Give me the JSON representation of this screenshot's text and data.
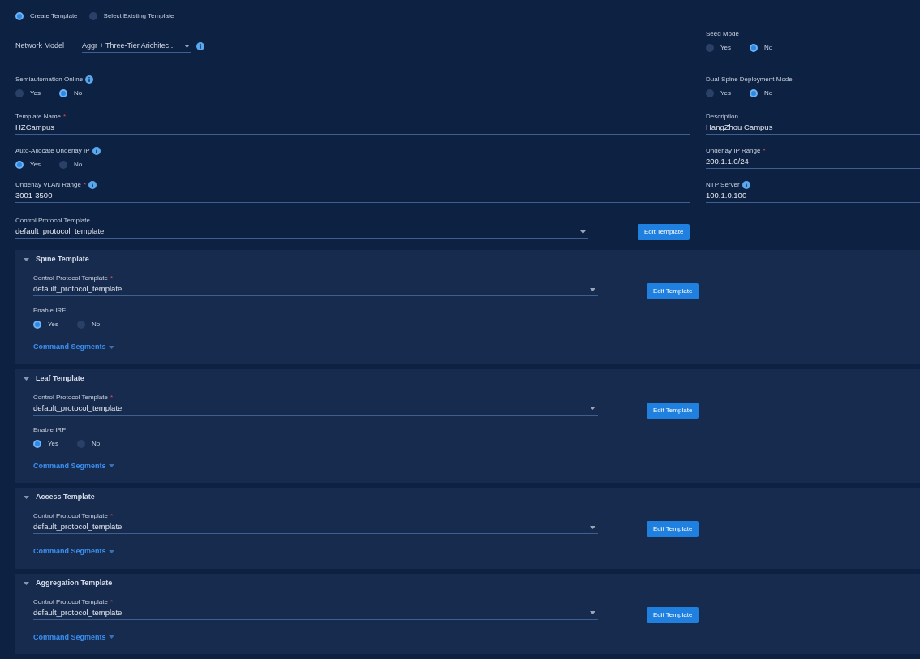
{
  "template_mode": [
    {
      "label": "Create Template",
      "selected": true
    },
    {
      "label": "Select Existing Template",
      "selected": false
    }
  ],
  "rows": [
    {
      "left": {
        "kind": "inline_select",
        "label": "Network Model",
        "value": "Aggr + Three-Tier Arichitec...",
        "info": true
      },
      "right": {
        "kind": "radio",
        "label": "Seed Mode",
        "options": [
          {
            "label": "Yes",
            "selected": false
          },
          {
            "label": "No",
            "selected": true
          }
        ]
      }
    },
    {
      "left": {
        "kind": "radio",
        "label": "Semiautomation Online",
        "info": true,
        "options": [
          {
            "label": "Yes",
            "selected": false
          },
          {
            "label": "No",
            "selected": true
          }
        ]
      },
      "right": {
        "kind": "radio",
        "label": "Dual-Spine Deployment Model",
        "options": [
          {
            "label": "Yes",
            "selected": false
          },
          {
            "label": "No",
            "selected": true
          }
        ]
      }
    },
    {
      "left": {
        "kind": "text",
        "label": "Template Name",
        "required_mark": "*",
        "value": "HZCampus"
      },
      "right": {
        "kind": "text",
        "label": "Description",
        "value": "HangZhou Campus"
      }
    },
    {
      "left": {
        "kind": "radio",
        "label": "Auto-Allocate Underlay IP",
        "info": true,
        "options": [
          {
            "label": "Yes",
            "selected": true
          },
          {
            "label": "No",
            "selected": false
          }
        ]
      },
      "right": {
        "kind": "text",
        "label": "Underlay IP Range",
        "required_mark": "*",
        "value": "200.1.1.0/24"
      }
    },
    {
      "left": {
        "kind": "text",
        "label": "Underlay VLAN Range",
        "required_mark": "*",
        "info": true,
        "value": "3001-3500"
      },
      "right": {
        "kind": "text",
        "label": "NTP Server",
        "info": true,
        "value": "100.1.0.100"
      }
    }
  ],
  "control_protocol": {
    "label": "Control Protocol Template",
    "value": "default_protocol_template",
    "button": "Edit Template"
  },
  "sections": [
    {
      "title": "Spine Template",
      "expanded": true,
      "select": {
        "label": "Control Protocol Template",
        "required_mark": "*",
        "value": "default_protocol_template"
      },
      "button": "Edit Template",
      "enable_irf": {
        "label": "Enable IRF",
        "options": [
          {
            "label": "Yes",
            "selected": true
          },
          {
            "label": "No",
            "selected": false
          }
        ]
      },
      "link": "Command Segments"
    },
    {
      "title": "Leaf Template",
      "expanded": true,
      "select": {
        "label": "Control Protocol Template",
        "required_mark": "*",
        "value": "default_protocol_template"
      },
      "button": "Edit Template",
      "enable_irf": {
        "label": "Enable IRF",
        "options": [
          {
            "label": "Yes",
            "selected": true
          },
          {
            "label": "No",
            "selected": false
          }
        ]
      },
      "link": "Command Segments"
    },
    {
      "title": "Access Template",
      "expanded": true,
      "select": {
        "label": "Control Protocol Template",
        "required_mark": "*",
        "value": "default_protocol_template"
      },
      "button": "Edit Template",
      "link": "Command Segments"
    },
    {
      "title": "Aggregation Template",
      "expanded": true,
      "select": {
        "label": "Control Protocol Template",
        "required_mark": "*",
        "value": "default_protocol_template"
      },
      "button": "Edit Template",
      "link": "Command Segments"
    }
  ]
}
